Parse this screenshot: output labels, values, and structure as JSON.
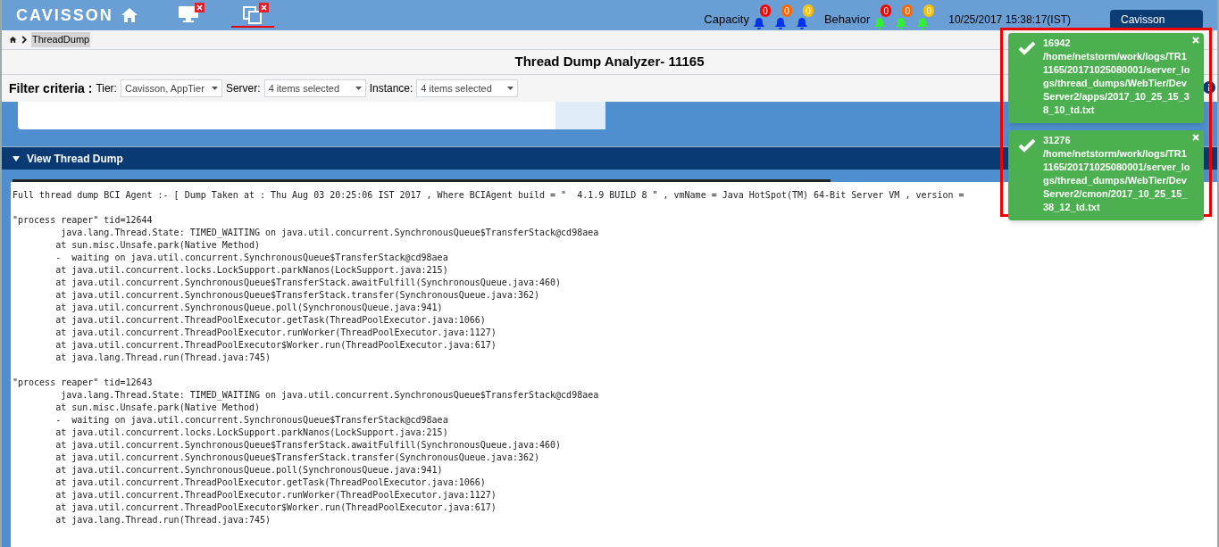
{
  "header": {
    "logo": "CAVISSON",
    "tabs": [
      {
        "kind": "monitor",
        "selected": false
      },
      {
        "kind": "windows",
        "selected": true
      }
    ],
    "capacity_label": "Capacity",
    "capacity_alerts": [
      {
        "count": "0",
        "color": "#ff0000"
      },
      {
        "count": "0",
        "color": "#ff6600"
      },
      {
        "count": "0",
        "color": "#ffc000"
      }
    ],
    "behavior_label": "Behavior",
    "behavior_alerts": [
      {
        "count": "0",
        "color": "#ff0000"
      },
      {
        "count": "0",
        "color": "#ff6600"
      },
      {
        "count": "0",
        "color": "#ffc000"
      }
    ],
    "datetime": "10/25/2017 15:38:17(IST)",
    "user": "Cavisson"
  },
  "breadcrumb": [
    "ThreadDump"
  ],
  "title": "Thread Dump Analyzer- 11165",
  "filter": {
    "label": "Filter criteria :",
    "fields": [
      {
        "label": "Tier:",
        "value": "Cavisson, AppTier"
      },
      {
        "label": "Server:",
        "value": "4 items selected"
      },
      {
        "label": "Instance:",
        "value": "4 items selected"
      }
    ]
  },
  "section": {
    "title": "View Thread Dump",
    "expanded": true
  },
  "dump_blocks": [
    [
      "Full thread dump BCI Agent :- [ Dump Taken at : Thu Aug 03 20:25:06 IST 2017 , Where BCIAgent build = \"  4.1.9 BUILD 8 \" , vmName = Java HotSpot(TM) 64-Bit Server VM , version ="
    ],
    [
      "\"process reaper\" tid=12644",
      "         java.lang.Thread.State: TIMED_WAITING on java.util.concurrent.SynchronousQueue$TransferStack@cd98aea",
      "        at sun.misc.Unsafe.park(Native Method)",
      "        -  waiting on java.util.concurrent.SynchronousQueue$TransferStack@cd98aea",
      "        at java.util.concurrent.locks.LockSupport.parkNanos(LockSupport.java:215)",
      "        at java.util.concurrent.SynchronousQueue$TransferStack.awaitFulfill(SynchronousQueue.java:460)",
      "        at java.util.concurrent.SynchronousQueue$TransferStack.transfer(SynchronousQueue.java:362)",
      "        at java.util.concurrent.SynchronousQueue.poll(SynchronousQueue.java:941)",
      "        at java.util.concurrent.ThreadPoolExecutor.getTask(ThreadPoolExecutor.java:1066)",
      "        at java.util.concurrent.ThreadPoolExecutor.runWorker(ThreadPoolExecutor.java:1127)",
      "        at java.util.concurrent.ThreadPoolExecutor$Worker.run(ThreadPoolExecutor.java:617)",
      "        at java.lang.Thread.run(Thread.java:745)"
    ],
    [
      "\"process reaper\" tid=12643",
      "         java.lang.Thread.State: TIMED_WAITING on java.util.concurrent.SynchronousQueue$TransferStack@cd98aea",
      "        at sun.misc.Unsafe.park(Native Method)",
      "        -  waiting on java.util.concurrent.SynchronousQueue$TransferStack@cd98aea",
      "        at java.util.concurrent.locks.LockSupport.parkNanos(LockSupport.java:215)",
      "        at java.util.concurrent.SynchronousQueue$TransferStack.awaitFulfill(SynchronousQueue.java:460)",
      "        at java.util.concurrent.SynchronousQueue$TransferStack.transfer(SynchronousQueue.java:362)",
      "        at java.util.concurrent.SynchronousQueue.poll(SynchronousQueue.java:941)",
      "        at java.util.concurrent.ThreadPoolExecutor.getTask(ThreadPoolExecutor.java:1066)",
      "        at java.util.concurrent.ThreadPoolExecutor.runWorker(ThreadPoolExecutor.java:1127)",
      "        at java.util.concurrent.ThreadPoolExecutor$Worker.run(ThreadPoolExecutor.java:617)",
      "        at java.lang.Thread.run(Thread.java:745)"
    ]
  ],
  "toasts": [
    {
      "title": "16942",
      "message": "/home/netstorm/work/logs/TR11165/20171025080001/server_logs/thread_dumps/WebTier/DevServer2/apps/2017_10_25_15_38_10_td.txt"
    },
    {
      "title": "31276",
      "message": "/home/netstorm/work/logs/TR11165/20171025080001/server_logs/thread_dumps/WebTier/DevServer2/cmon/2017_10_25_15_38_12_td.txt"
    }
  ]
}
